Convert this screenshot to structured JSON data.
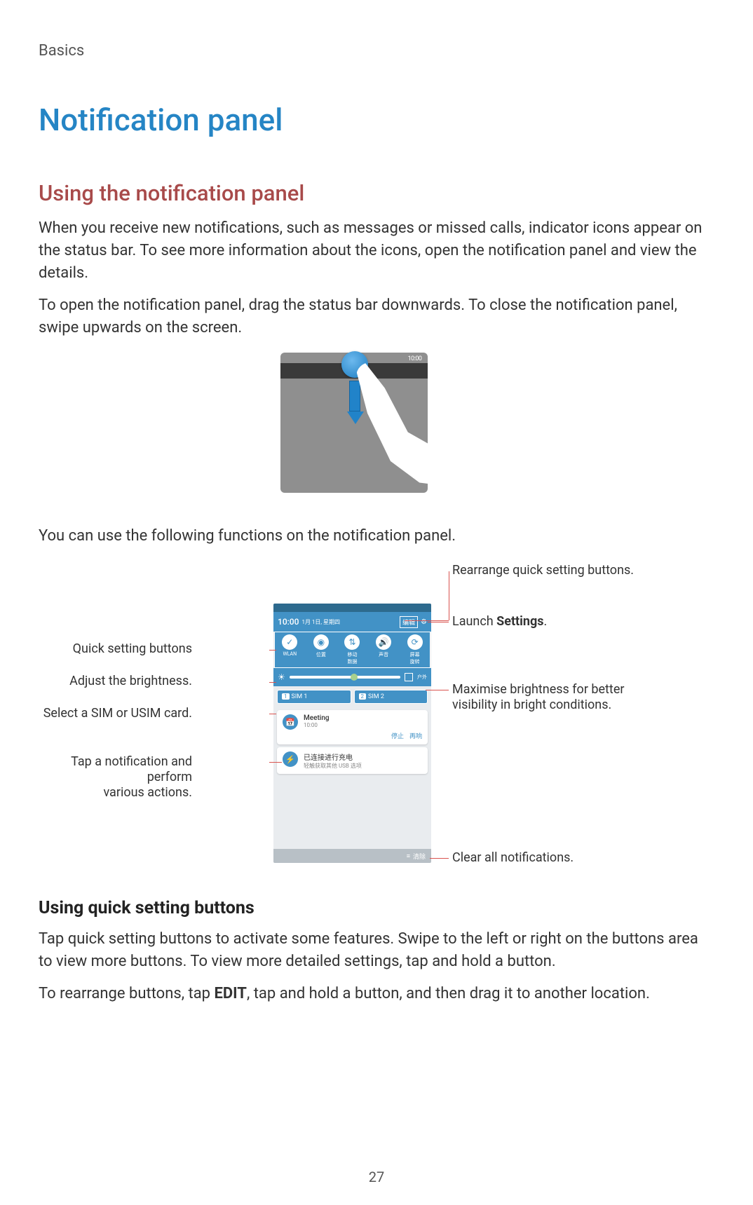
{
  "header": {
    "section": "Basics"
  },
  "title": "Notification panel",
  "subtitle": "Using the notification panel",
  "body": {
    "p1": "When you receive new notifications, such as messages or missed calls, indicator icons appear on the status bar. To see more information about the icons, open the notification panel and view the details.",
    "p2": "To open the notification panel, drag the status bar downwards. To close the notification panel, swipe upwards on the screen.",
    "p3": "You can use the following functions on the notification panel."
  },
  "section2": {
    "heading": "Using quick setting buttons",
    "p1": "Tap quick setting buttons to activate some features. Swipe to the left or right on the buttons area to view more buttons. To view more detailed settings, tap and hold a button.",
    "p2_a": "To rearrange buttons, tap ",
    "p2_b": "EDIT",
    "p2_c": ", tap and hold a button, and then drag it to another location."
  },
  "callouts": {
    "rearrange": "Rearrange quick setting buttons.",
    "launch_a": "Launch ",
    "launch_b": "Settings",
    "launch_c": ".",
    "qs": "Quick setting buttons",
    "brightness": "Adjust the brightness.",
    "sim": "Select a SIM or USIM card.",
    "notif_a": "Tap a notification and perform",
    "notif_b": "various actions.",
    "max_a": "Maximise brightness for better",
    "max_b": "visibility in bright conditions.",
    "clear": "Clear all notifications."
  },
  "panel": {
    "time": "10:00",
    "date": "1月 1日, 星期四",
    "edit": "编辑",
    "qs": {
      "a": "WLAN",
      "b": "位置",
      "c": "移动\n数据",
      "d": "声音",
      "e": "屏幕\n旋转"
    },
    "bright_label": "户外",
    "sim1": "SIM 1",
    "sim2": "SIM 2",
    "notif1_title": "Meeting",
    "notif1_sub": "10:00",
    "notif1_act1": "停止",
    "notif1_act2": "再响",
    "notif2_title": "已连接进行充电",
    "notif2_sub": "轻触获取其他 USB 选项",
    "clear": "清除"
  },
  "status_time": "10:00",
  "page": "27"
}
